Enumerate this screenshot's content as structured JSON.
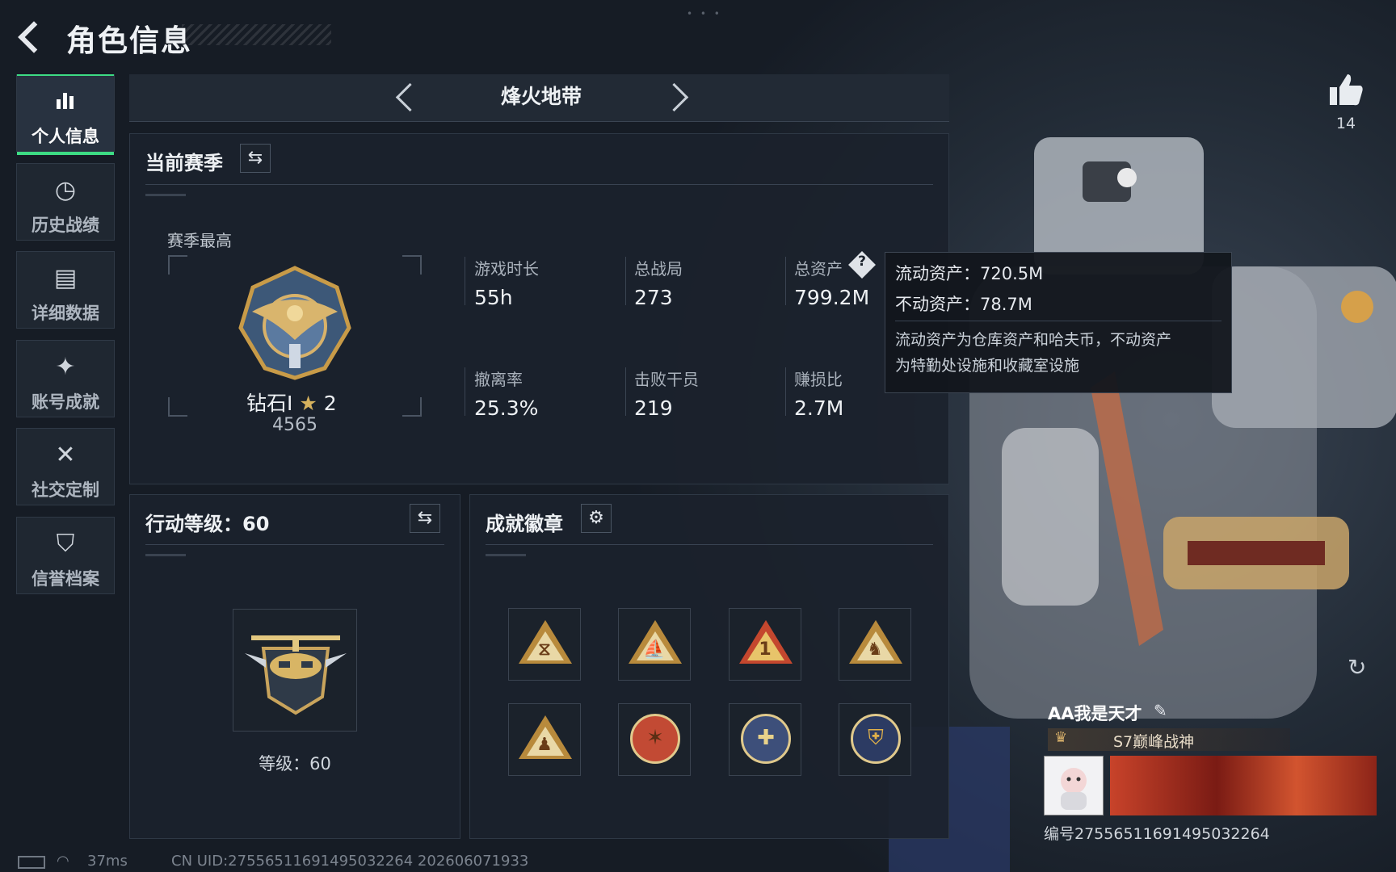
{
  "header": {
    "title": "角色信息"
  },
  "sidebar": {
    "items": [
      {
        "label": "个人信息",
        "icon": "bar-chart-icon",
        "active": true
      },
      {
        "label": "历史战绩",
        "icon": "history-clock-icon"
      },
      {
        "label": "详细数据",
        "icon": "folder-icon"
      },
      {
        "label": "账号成就",
        "icon": "achievement-icon"
      },
      {
        "label": "社交定制",
        "icon": "tools-icon"
      },
      {
        "label": "信誉档案",
        "icon": "shield-icon"
      }
    ]
  },
  "mode": {
    "label": "烽火地带"
  },
  "season": {
    "title": "当前赛季",
    "best_label": "赛季最高",
    "rank_name": "钻石I",
    "rank_stars": "2",
    "rank_score": "4565",
    "stats": [
      {
        "label": "游戏时长",
        "value": "55h"
      },
      {
        "label": "总战局",
        "value": "273"
      },
      {
        "label": "总资产",
        "value": "799.2M"
      },
      {
        "label": "撤离率",
        "value": "25.3%"
      },
      {
        "label": "击败干员",
        "value": "219"
      },
      {
        "label": "赚损比",
        "value": "2.7M"
      }
    ]
  },
  "tooltip": {
    "line1": "流动资产：720.5M",
    "line2": "不动资产：78.7M",
    "desc1": "流动资产为仓库资产和哈夫币，不动资产",
    "desc2": "为特勤处设施和收藏室设施"
  },
  "level": {
    "title": "行动等级：60",
    "level_text": "等级：60"
  },
  "badges": {
    "title": "成就徽章"
  },
  "like": {
    "count": "14"
  },
  "profile": {
    "name": "AA我是天才",
    "title": "S7巅峰战神",
    "id_text": "编号2755651169149503226​4"
  },
  "status": {
    "ping": "37ms",
    "uid": "CN UID:2755651169149503226​4 202606071933"
  }
}
